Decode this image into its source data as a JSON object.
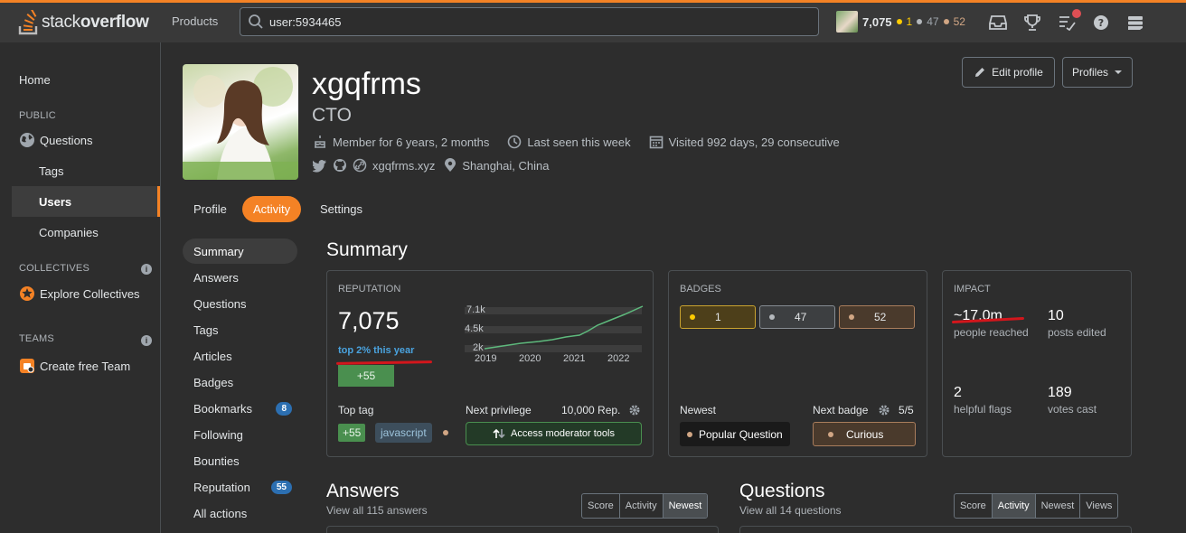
{
  "topbar": {
    "logo_text_light": "stack",
    "logo_text_bold": "overflow",
    "products_label": "Products",
    "search_value": "user:5934465",
    "user_rep": "7,075",
    "gold_count": "1",
    "silver_count": "47",
    "bronze_count": "52",
    "icons": [
      "inbox-icon",
      "achievements-icon",
      "review-icon",
      "help-icon",
      "site-switcher-icon"
    ]
  },
  "sidebar": {
    "home": "Home",
    "public_heading": "PUBLIC",
    "questions": "Questions",
    "tags": "Tags",
    "users": "Users",
    "companies": "Companies",
    "collectives_heading": "COLLECTIVES",
    "explore_collectives": "Explore Collectives",
    "teams_heading": "TEAMS",
    "create_team": "Create free Team",
    "info_glyph": "i"
  },
  "profile": {
    "name": "xgqfrms",
    "title": "CTO",
    "member_for": "Member for 6 years, 2 months",
    "last_seen": "Last seen this week",
    "visited": "Visited 992 days, 29 consecutive",
    "website": "xgqfrms.xyz",
    "location": "Shanghai, China",
    "edit_profile": "Edit profile",
    "profiles": "Profiles"
  },
  "tabs": [
    {
      "label": "Profile"
    },
    {
      "label": "Activity",
      "active": true
    },
    {
      "label": "Settings"
    }
  ],
  "side_menu": [
    {
      "label": "Summary",
      "active": true
    },
    {
      "label": "Answers"
    },
    {
      "label": "Questions"
    },
    {
      "label": "Tags"
    },
    {
      "label": "Articles"
    },
    {
      "label": "Badges"
    },
    {
      "label": "Bookmarks",
      "count": "8"
    },
    {
      "label": "Following"
    },
    {
      "label": "Bounties"
    },
    {
      "label": "Reputation",
      "count": "55"
    },
    {
      "label": "All actions"
    }
  ],
  "summary": {
    "title": "Summary",
    "reputation": {
      "heading": "REPUTATION",
      "value": "7,075",
      "top_pct": "top 2% this year",
      "gain": "+55",
      "chart": {
        "y_ticks": [
          "7.1k",
          "4.5k",
          "2k"
        ],
        "x_ticks": [
          "2019",
          "2020",
          "2021",
          "2022"
        ],
        "line_color": "#5eba7d"
      },
      "top_tag_label": "Top tag",
      "top_tag_gain": "+55",
      "top_tag": "javascript",
      "next_privilege_label": "Next privilege",
      "next_privilege_rep": "10,000 Rep.",
      "next_privilege": "Access moderator tools"
    },
    "badges": {
      "heading": "BADGES",
      "gold": "1",
      "silver": "47",
      "bronze": "52",
      "newest_label": "Newest",
      "newest": "Popular Question",
      "next_badge_label": "Next badge",
      "next_badge_progress": "5/5",
      "next_badge": "Curious"
    },
    "impact": {
      "heading": "IMPACT",
      "people_reached": "~17.0m",
      "people_reached_label": "people reached",
      "posts_edited": "10",
      "posts_edited_label": "posts edited",
      "helpful_flags": "2",
      "helpful_flags_label": "helpful flags",
      "votes_cast": "189",
      "votes_cast_label": "votes cast"
    }
  },
  "answers": {
    "title": "Answers",
    "subtitle": "View all 115 answers",
    "sort": [
      "Score",
      "Activity",
      "Newest"
    ],
    "sort_active": "Newest"
  },
  "questions": {
    "title": "Questions",
    "subtitle": "View all 14 questions",
    "sort": [
      "Score",
      "Activity",
      "Newest",
      "Views"
    ],
    "sort_active": "Activity"
  },
  "colors": {
    "accent": "#f48225",
    "annotation_red": "#d3161c",
    "link_blue": "#4aa3df",
    "success_green": "#4a8f4f"
  }
}
